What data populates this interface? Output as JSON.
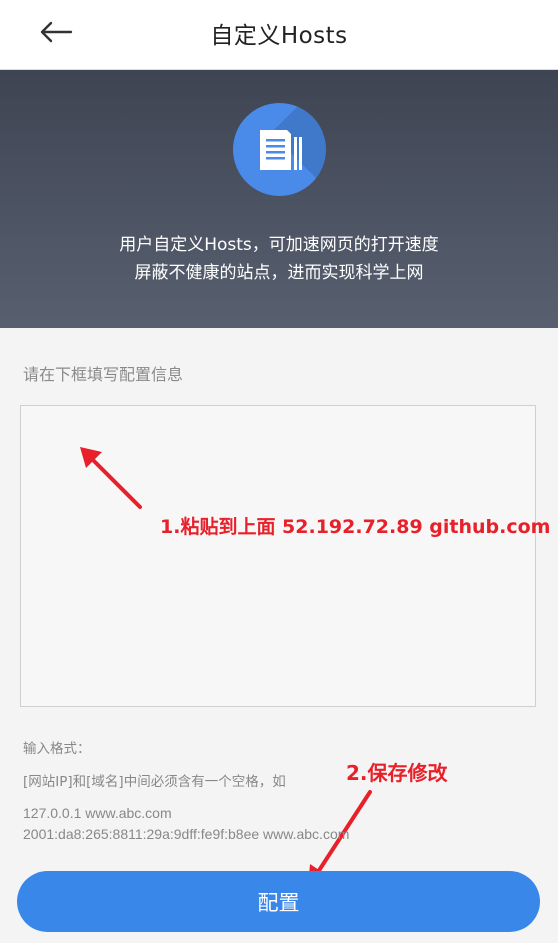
{
  "header": {
    "title": "自定义Hosts",
    "back_icon": "arrow-left-icon"
  },
  "banner": {
    "icon": "document-icon",
    "line1": "用户自定义Hosts，可加速网页的打开速度",
    "line2": "屏蔽不健康的站点，进而实现科学上网",
    "accent_color": "#4a8ae8"
  },
  "form": {
    "hint": "请在下框填写配置信息",
    "hosts_value": "",
    "format_title": "输入格式：",
    "format_rule": "[网站IP]和[域名]中间必须含有一个空格，如",
    "example1": "127.0.0.1 www.abc.com",
    "example2": "2001:da8:265:8811:29a:9dff:fe9f:b8ee www.abc.com",
    "submit_label": "配置",
    "button_color": "#3a87ea"
  },
  "annotations": {
    "step1": "1.粘贴到上面 52.192.72.89 github.com",
    "step2": "2.保存修改",
    "color": "#e8202a"
  }
}
